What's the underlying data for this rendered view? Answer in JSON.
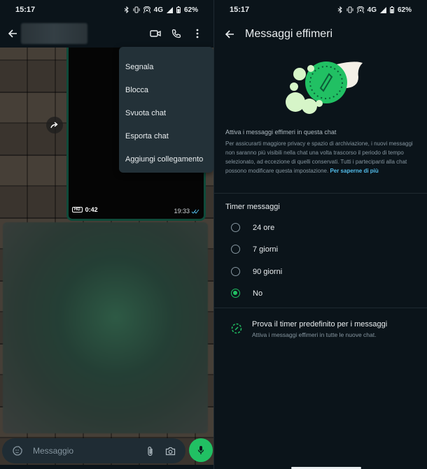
{
  "status_bar": {
    "time": "15:17",
    "network": "4G",
    "battery": "62%"
  },
  "chat": {
    "video": {
      "quality_badge": "HD",
      "duration": "0:42",
      "timestamp": "19:33"
    },
    "menu": {
      "items": [
        {
          "label": "Segnala"
        },
        {
          "label": "Blocca"
        },
        {
          "label": "Svuota chat"
        },
        {
          "label": "Esporta chat"
        },
        {
          "label": "Aggiungi collegamento"
        }
      ]
    },
    "composer": {
      "placeholder": "Messaggio"
    },
    "colors": {
      "accent": "#21c063",
      "menu_bg": "#233138",
      "header_bg": "#0b141a"
    }
  },
  "settings": {
    "title": "Messaggi effimeri",
    "description_title": "Attiva i messaggi effimeri in questa chat",
    "description_body": "Per assicurarti maggiore privacy e spazio di archiviazione, i nuovi messaggi non saranno più visibili nella chat una volta trascorso il periodo di tempo selezionato, ad eccezione di quelli conservati. Tutti i partecipanti alla chat possono modificare questa impostazione.",
    "description_link": "Per saperne di più",
    "timer_section_title": "Timer messaggi",
    "timer_options": [
      {
        "label": "24 ore",
        "selected": false
      },
      {
        "label": "7 giorni",
        "selected": false
      },
      {
        "label": "90 giorni",
        "selected": false
      },
      {
        "label": "No",
        "selected": true
      }
    ],
    "default_timer": {
      "title": "Prova il timer predefinito per i messaggi",
      "subtitle": "Attiva i messaggi effimeri in tutte le nuove chat."
    },
    "colors": {
      "accent": "#21c063",
      "link": "#53bdeb",
      "background": "#0b141a"
    }
  }
}
